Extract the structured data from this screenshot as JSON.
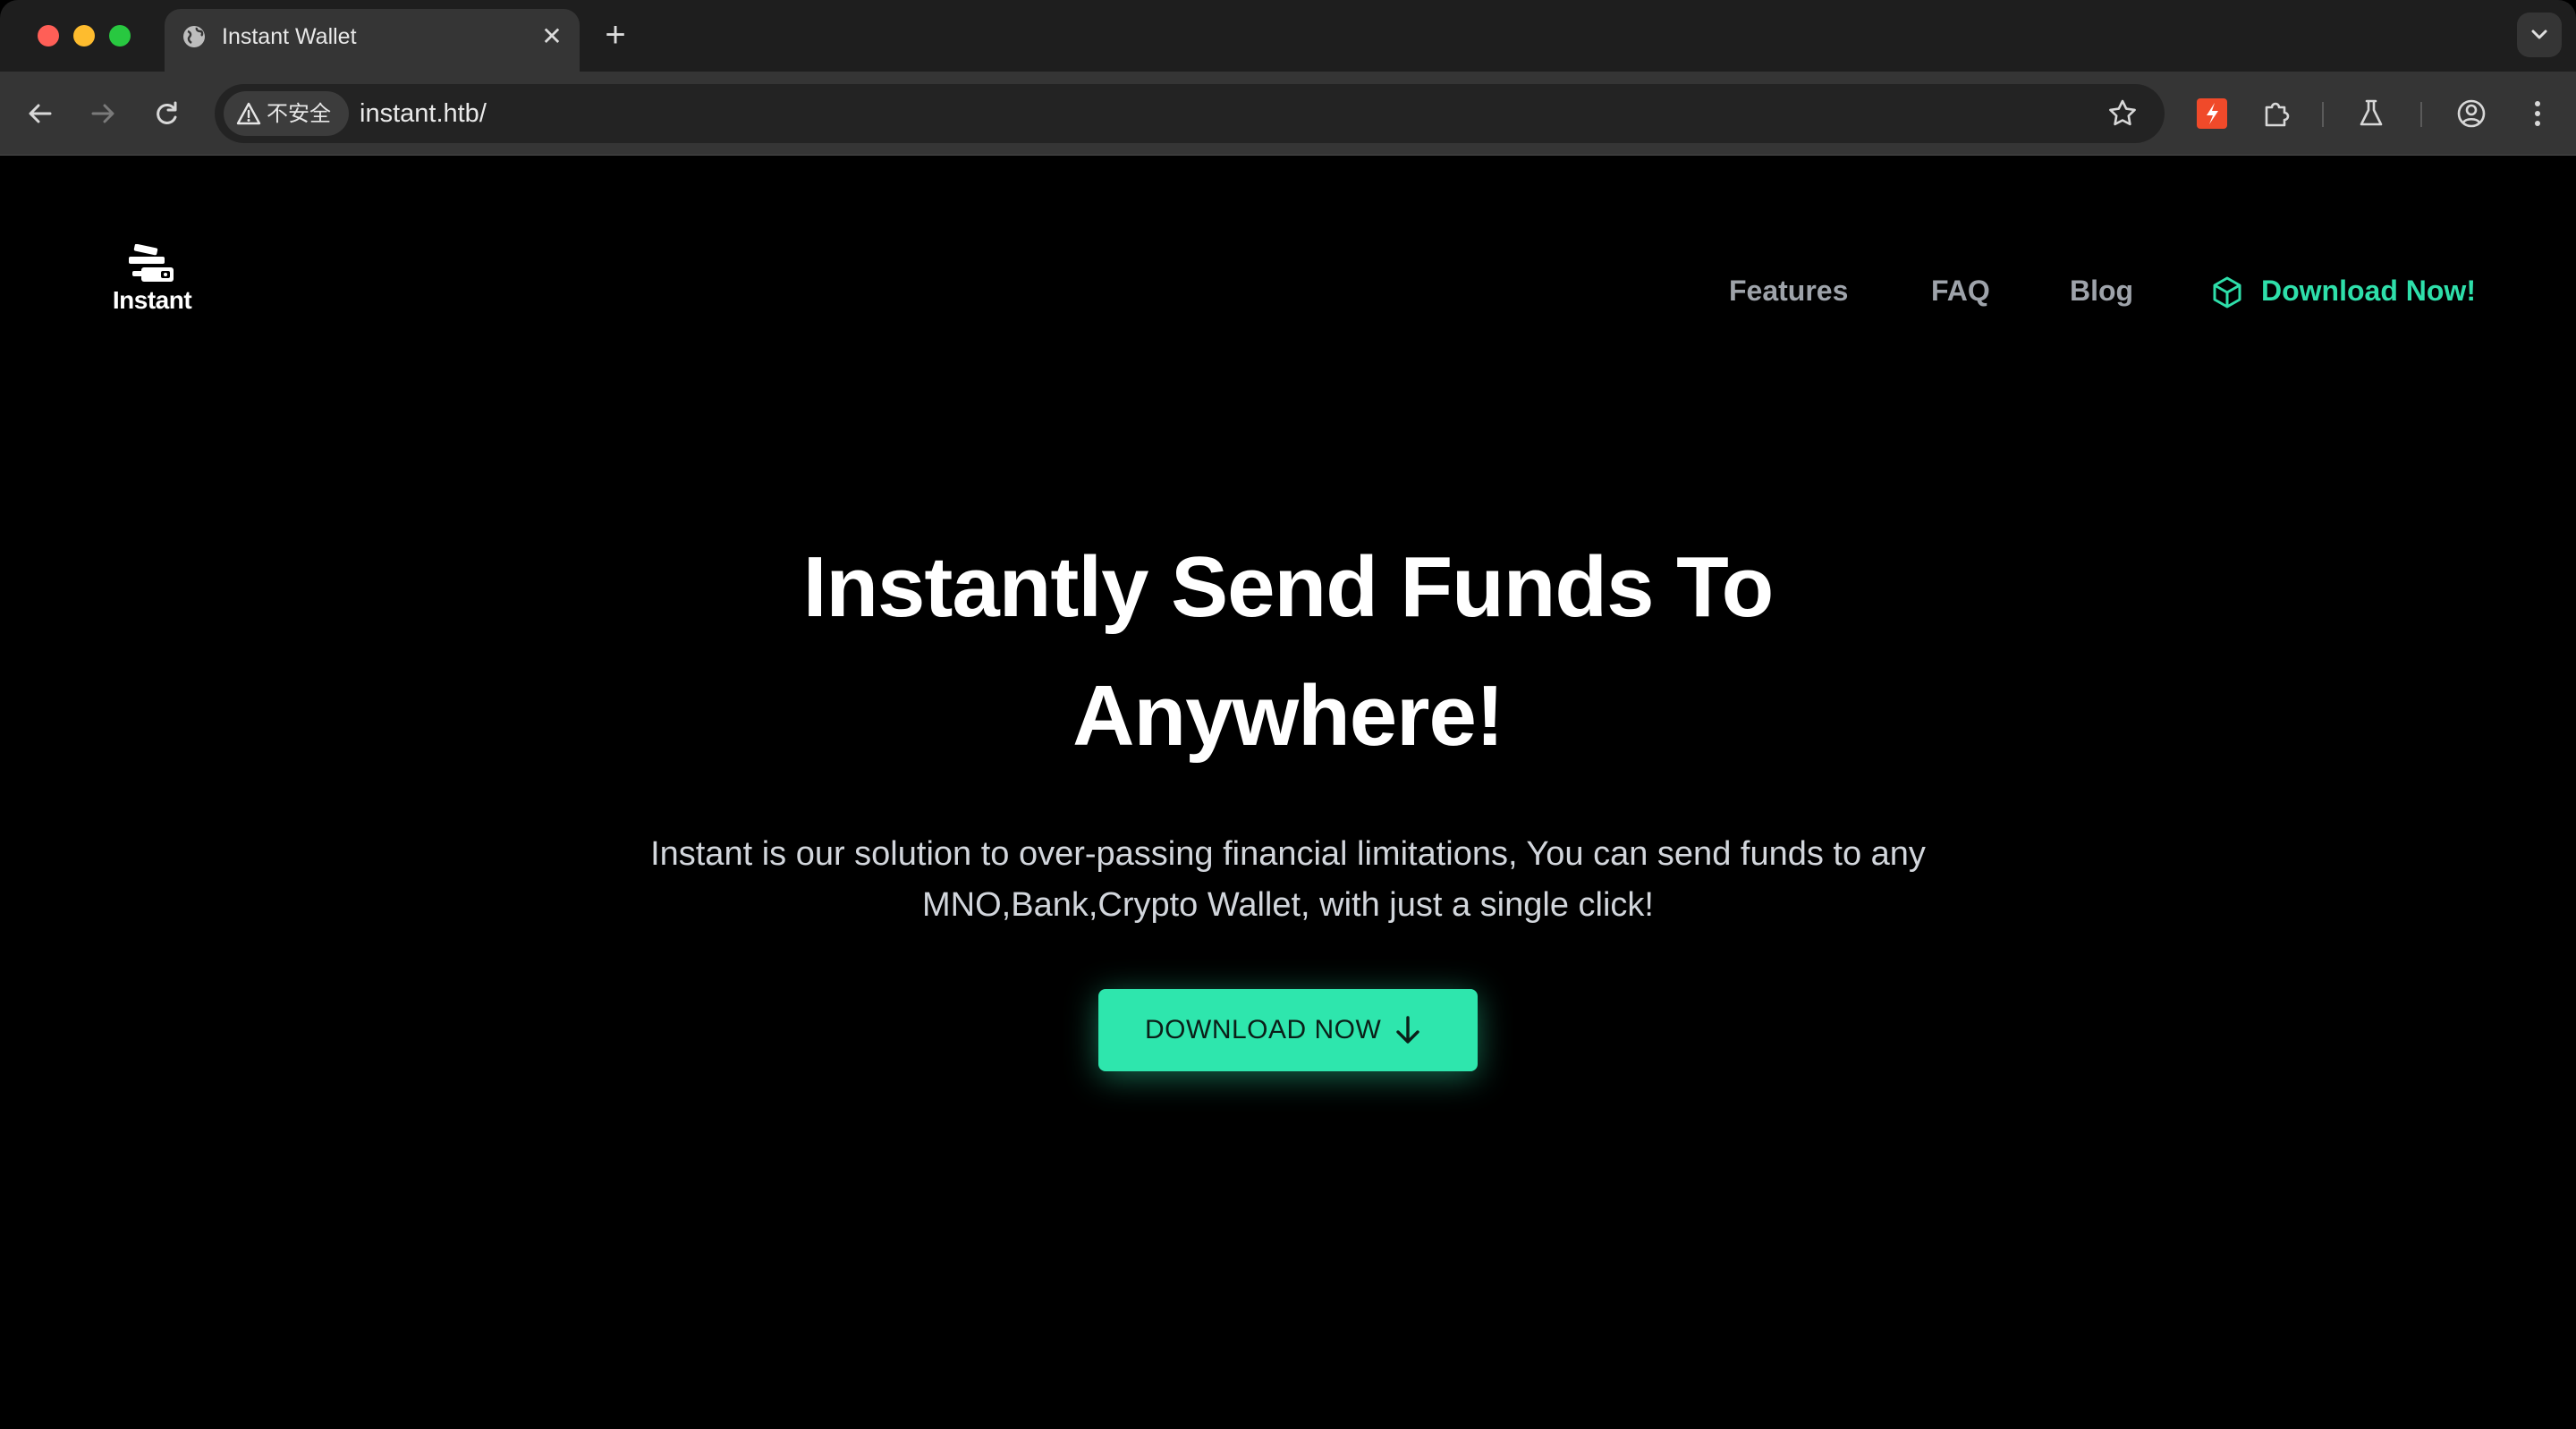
{
  "browser": {
    "tab": {
      "title": "Instant Wallet",
      "close_glyph": "✕",
      "icon": "globe-icon"
    },
    "new_tab_glyph": "+",
    "toolbar": {
      "security_label": "不安全",
      "url": "instant.htb/"
    },
    "extension_color": "#f04a2a"
  },
  "site": {
    "logo_text": "Instant",
    "nav": {
      "features": "Features",
      "faq": "FAQ",
      "blog": "Blog",
      "download": "Download Now!"
    },
    "hero": {
      "title_line1": "Instantly Send Funds To",
      "title_line2": "Anywhere!",
      "subtitle": "Instant is our solution to over-passing financial limitations, You can send funds to any MNO,Bank,Crypto Wallet, with just a single click!",
      "cta_label": "DOWNLOAD NOW"
    },
    "colors": {
      "accent": "#2ee6ad",
      "background": "#000000",
      "nav_text": "#9ea3aa"
    }
  }
}
